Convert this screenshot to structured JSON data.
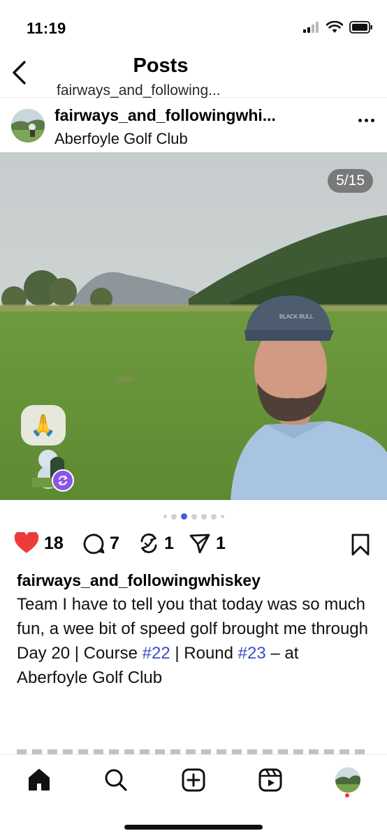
{
  "status_bar": {
    "time": "11:19",
    "icons": [
      "signal-icon",
      "wifi-icon",
      "battery-icon"
    ]
  },
  "header": {
    "back_icon": "chevron-left-icon",
    "title": "Posts",
    "subtitle": "fairways_and_following..."
  },
  "post": {
    "username": "fairways_and_followingwhi...",
    "location": "Aberfoyle Golf Club",
    "more_icon": "more-horizontal-icon",
    "image_counter": "5/15",
    "reaction_emoji": "🙏",
    "repost_icon": "repost-icon",
    "carousel": {
      "total_dots": 7,
      "active_index": 2
    }
  },
  "actions": {
    "likes": "18",
    "comments": "7",
    "reposts": "1",
    "shares": "1",
    "icons": [
      "heart-filled-icon",
      "comment-icon",
      "repost-icon",
      "share-icon",
      "bookmark-icon"
    ],
    "like_color": "#ed3b3b"
  },
  "caption": {
    "username": "fairways_and_followingwhiskey",
    "text_1": "Team I have to tell you that today was so much fun, a wee bit of speed golf brought me through Day 20 | Course ",
    "hashtag_1": "#22",
    "text_2": " | Round ",
    "hashtag_2": "#23",
    "text_3": " – at Aberfoyle Golf Club",
    "hashtag_color": "#3a4fc4"
  },
  "tab_bar": {
    "tabs": [
      "home-icon",
      "search-icon",
      "create-post-icon",
      "reels-icon",
      "profile-avatar"
    ]
  }
}
